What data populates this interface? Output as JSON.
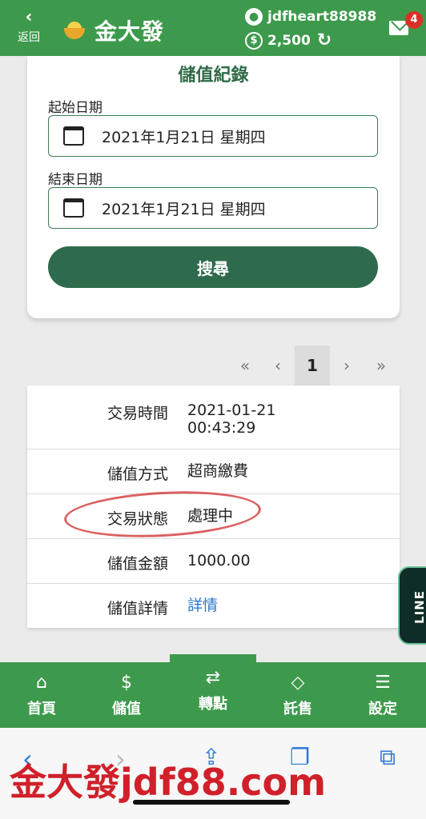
{
  "header": {
    "back_icon": "chevron-left-icon",
    "back_label": "返回",
    "brand": "金大發",
    "username": "jdfheart88988",
    "balance": "2,500",
    "mail_badge": "4",
    "bg_color": "#3d9a4c"
  },
  "search": {
    "title": "儲值紀錄",
    "start_label": "起始日期",
    "start_value": "2021年1月21日 星期四",
    "end_label": "結束日期",
    "end_value": "2021年1月21日 星期四",
    "button": "搜尋",
    "button_color": "#2e6b4c"
  },
  "pagination": {
    "first": "«",
    "prev": "‹",
    "current": "1",
    "next": "›",
    "last": "»"
  },
  "record": {
    "rows": [
      {
        "label": "交易時間",
        "value_line1": "2021-01-21",
        "value_line2": "00:43:29"
      },
      {
        "label": "儲值方式",
        "value": "超商繳費"
      },
      {
        "label": "交易狀態",
        "value": "處理中"
      },
      {
        "label": "儲值金額",
        "value": "1000.00"
      },
      {
        "label": "儲值詳情",
        "value": "詳情"
      }
    ]
  },
  "line_tab": "LINE",
  "bottom_nav": {
    "items": [
      {
        "icon": "home-icon",
        "label": "首頁"
      },
      {
        "icon": "dollar-icon",
        "label": "儲值"
      },
      {
        "icon": "exchange-icon",
        "label": "轉點"
      },
      {
        "icon": "diamond-icon",
        "label": "託售"
      },
      {
        "icon": "settings-icon",
        "label": "設定"
      }
    ]
  },
  "watermark": "金大發jdf88.com"
}
